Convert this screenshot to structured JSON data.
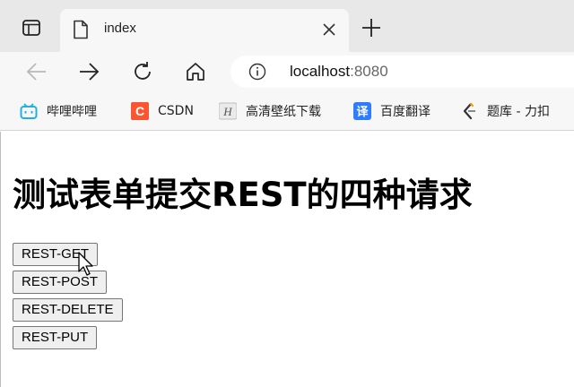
{
  "tab": {
    "title": "index"
  },
  "address_bar": {
    "host": "localhost",
    "port": ":8080"
  },
  "bookmarks": [
    {
      "label": "哔哩哔哩",
      "icon": "bilibili-icon"
    },
    {
      "label": "CSDN",
      "icon": "csdn-icon"
    },
    {
      "label": "高清壁纸下载",
      "icon": "wallpaper-site-icon"
    },
    {
      "label": "百度翻译",
      "icon": "baidu-translate-icon"
    },
    {
      "label": "题库 - 力扣",
      "icon": "leetcode-icon"
    }
  ],
  "page": {
    "heading": "测试表单提交REST的四种请求",
    "buttons": [
      "REST-GET",
      "REST-POST",
      "REST-DELETE",
      "REST-PUT"
    ]
  },
  "colors": {
    "tab_strip": "#e8e8e8",
    "toolbar": "#f7f7f7",
    "bilibili": "#23ade5",
    "csdn": "#fc5531",
    "baidu_translate": "#2f7dff",
    "button_bg": "#efefef"
  }
}
